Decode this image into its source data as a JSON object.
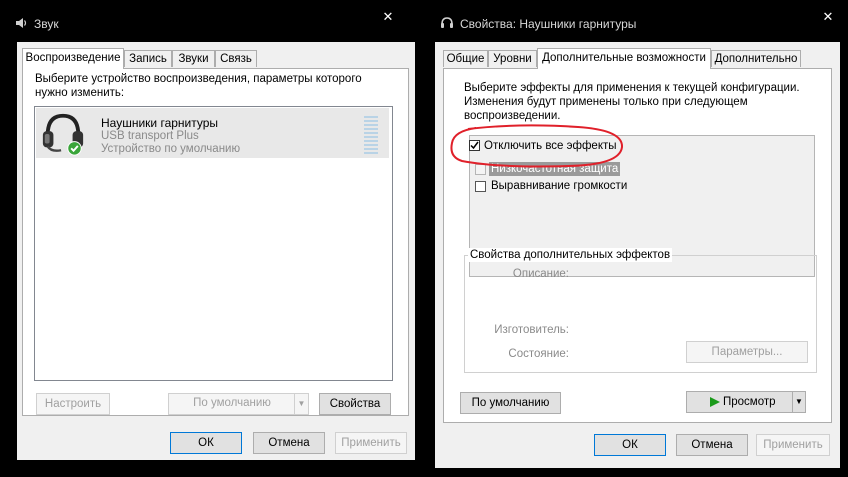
{
  "sound_window": {
    "title": "Звук",
    "tabs": [
      "Воспроизведение",
      "Запись",
      "Звуки",
      "Связь"
    ],
    "instruction": "Выберите устройство воспроизведения, параметры которого нужно изменить:",
    "device": {
      "name": "Наушники гарнитуры",
      "subtitle": "USB transport Plus",
      "status": "Устройство по умолчанию"
    },
    "configure_label": "Настроить",
    "default_dropdown_label": "По умолчанию",
    "properties_label": "Свойства",
    "ok_label": "ОК",
    "cancel_label": "Отмена",
    "apply_label": "Применить"
  },
  "props_window": {
    "title": "Свойства: Наушники гарнитуры",
    "tabs": [
      "Общие",
      "Уровни",
      "Дополнительные возможности",
      "Дополнительно"
    ],
    "instruction": "Выберите эффекты для применения к текущей конфигурации. Изменения будут применены только при следующем воспроизведении.",
    "disable_all_label": "Отключить все эффекты",
    "disable_all_checked": true,
    "effects": [
      "Низкочастотная защита",
      "Выравнивание громкости"
    ],
    "group_title": "Свойства дополнительных эффектов",
    "description_label": "Описание:",
    "manufacturer_label": "Изготовитель:",
    "state_label": "Состояние:",
    "params_label": "Параметры...",
    "restore_default_label": "По умолчанию",
    "preview_label": "Просмотр",
    "ok_label": "ОК",
    "cancel_label": "Отмена",
    "apply_label": "Применить"
  },
  "colors": {
    "highlight_circle": "#e0202a",
    "preview_arrow": "#1a9a1a",
    "check_green": "#3aa53a"
  }
}
